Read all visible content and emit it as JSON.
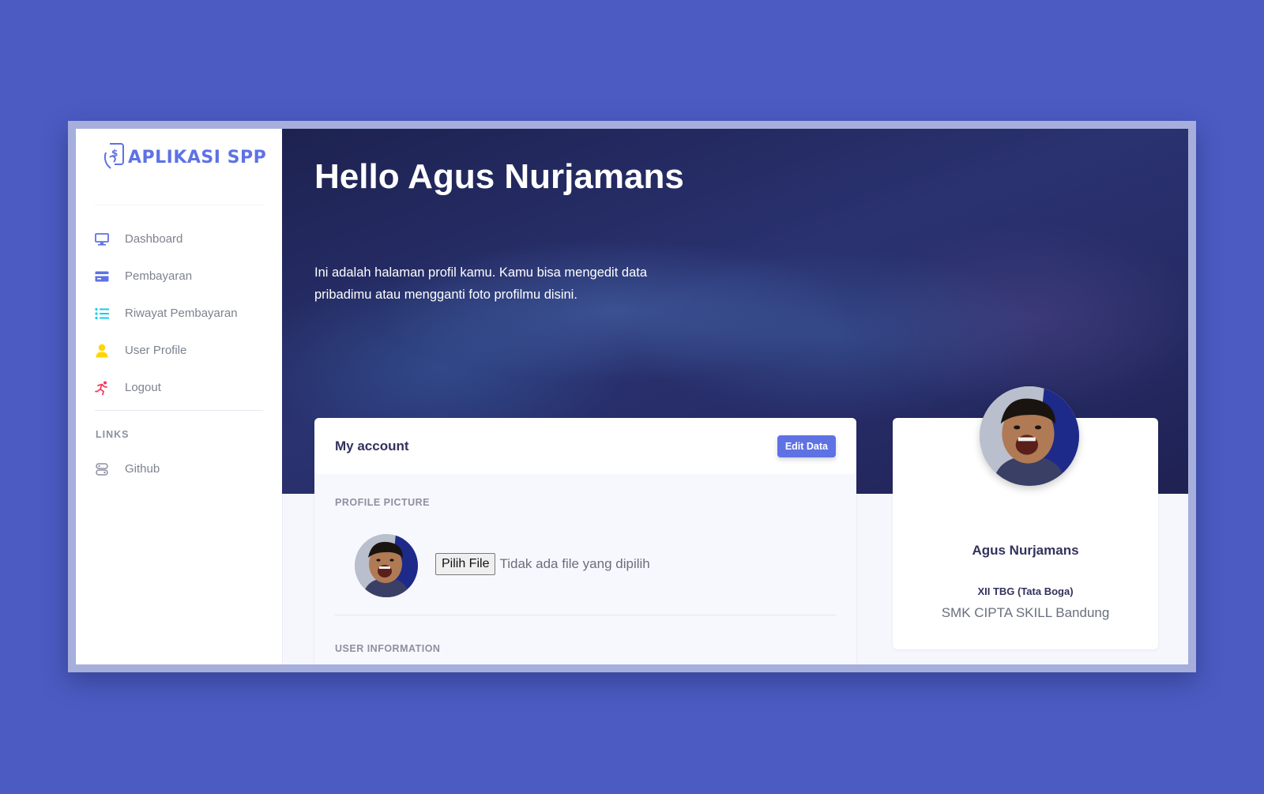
{
  "brand": {
    "name": "APLIKASI SPP",
    "color": "#5e72e4"
  },
  "sidebar": {
    "items": [
      {
        "label": "Dashboard",
        "icon": "monitor-icon",
        "color": "#5e72e4"
      },
      {
        "label": "Pembayaran",
        "icon": "credit-card-icon",
        "color": "#5e72e4"
      },
      {
        "label": "Riwayat Pembayaran",
        "icon": "list-icon",
        "color": "#11cdef"
      },
      {
        "label": "User Profile",
        "icon": "user-icon",
        "color": "#ffd600"
      },
      {
        "label": "Logout",
        "icon": "running-icon",
        "color": "#f5365c"
      }
    ],
    "links_heading": "LINKS",
    "links": [
      {
        "label": "Github",
        "icon": "github-icon",
        "color": "#8c90a0"
      }
    ]
  },
  "header": {
    "greeting": "Hello Agus Nurjamans",
    "intro": "Ini adalah halaman profil kamu. Kamu bisa mengedit data pribadimu atau mengganti foto profilmu disini."
  },
  "account": {
    "title": "My account",
    "edit_label": "Edit Data",
    "profile_picture_heading": "PROFILE PICTURE",
    "file_button": "Pilih File",
    "file_status": "Tidak ada file yang dipilih",
    "user_information_heading": "USER INFORMATION"
  },
  "profile": {
    "name": "Agus Nurjamans",
    "class": "XII TBG (Tata Boga)",
    "school": "SMK CIPTA SKILL Bandung"
  }
}
